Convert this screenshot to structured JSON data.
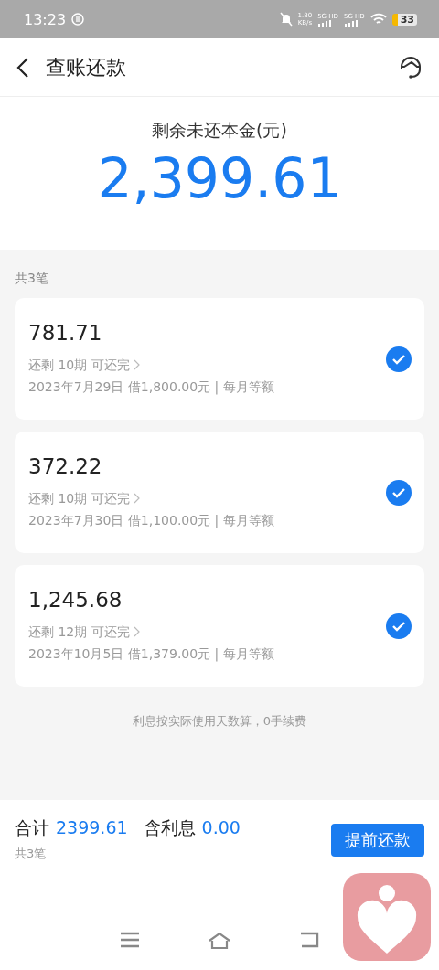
{
  "status_bar": {
    "time": "13:23",
    "speed": "1.80",
    "speed_unit": "KB/s",
    "sim_labels": [
      "5G HD",
      "5G HD"
    ],
    "battery": "33"
  },
  "header": {
    "title": "查账还款"
  },
  "summary": {
    "label": "剩余未还本金(元)",
    "amount": "2,399.61"
  },
  "count_label": "共3笔",
  "loans": [
    {
      "amount": "781.71",
      "remaining": "还剩 10期 可还完",
      "details": "2023年7月29日 借1,800.00元 | 每月等额",
      "checked": true
    },
    {
      "amount": "372.22",
      "remaining": "还剩 10期 可还完",
      "details": "2023年7月30日 借1,100.00元 | 每月等额",
      "checked": true
    },
    {
      "amount": "1,245.68",
      "remaining": "还剩 12期 可还完",
      "details": "2023年10月5日 借1,379.00元 | 每月等额",
      "checked": true
    }
  ],
  "note": "利息按实际使用天数算，0手续费",
  "footer": {
    "total_label": "合计",
    "total": "2399.61",
    "interest_label": "含利息",
    "interest": "0.00",
    "count": "共3笔",
    "button": "提前还款"
  }
}
